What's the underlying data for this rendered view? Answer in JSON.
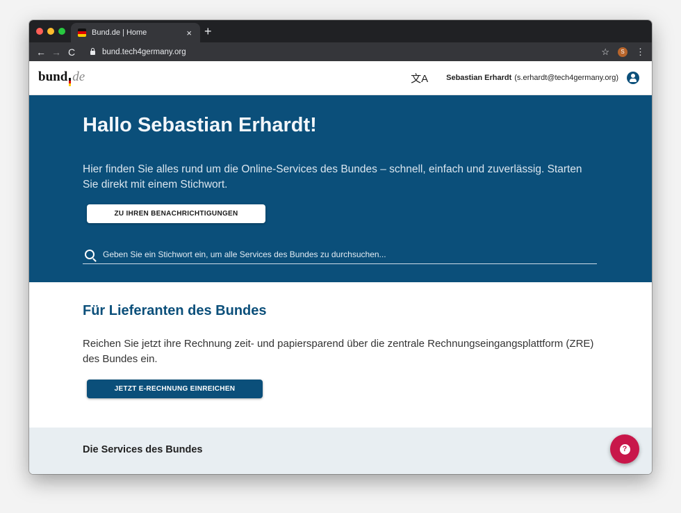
{
  "browser": {
    "tab_title": "Bund.de | Home",
    "tab_close": "×",
    "new_tab": "+",
    "url": "bund.tech4germany.org",
    "profile_initial": "S",
    "back": "←",
    "forward": "→",
    "reload": "C",
    "star": "☆",
    "menu": "⋮"
  },
  "header": {
    "logo_text": "bund",
    "logo_de": "de",
    "translate_icon": "文A",
    "user_name": "Sebastian Erhardt",
    "user_email": "(s.erhardt@tech4germany.org)"
  },
  "hero": {
    "title": "Hallo Sebastian Erhardt!",
    "text": "Hier finden Sie alles rund um die Online-Services des Bundes – schnell, einfach und zuverlässig. Starten Sie direkt mit einem Stichwort.",
    "notify_button": "ZU IHREN BENACHRICHTIGUNGEN",
    "search_placeholder": "Geben Sie ein Stichwort ein, um alle Services des Bundes zu durchsuchen..."
  },
  "suppliers": {
    "title": "Für Lieferanten des Bundes",
    "text": "Reichen Sie jetzt ihre Rechnung zeit- und papiersparend über die zentrale Rechnungseingangsplattform (ZRE) des Bundes ein.",
    "button": "JETZT E-RECHNUNG EINREICHEN"
  },
  "services": {
    "title": "Die Services des Bundes"
  },
  "help": {
    "icon": "?"
  },
  "colors": {
    "primary": "#0b4f7a",
    "help": "#c8174a",
    "services_bg": "#e8eef2"
  }
}
